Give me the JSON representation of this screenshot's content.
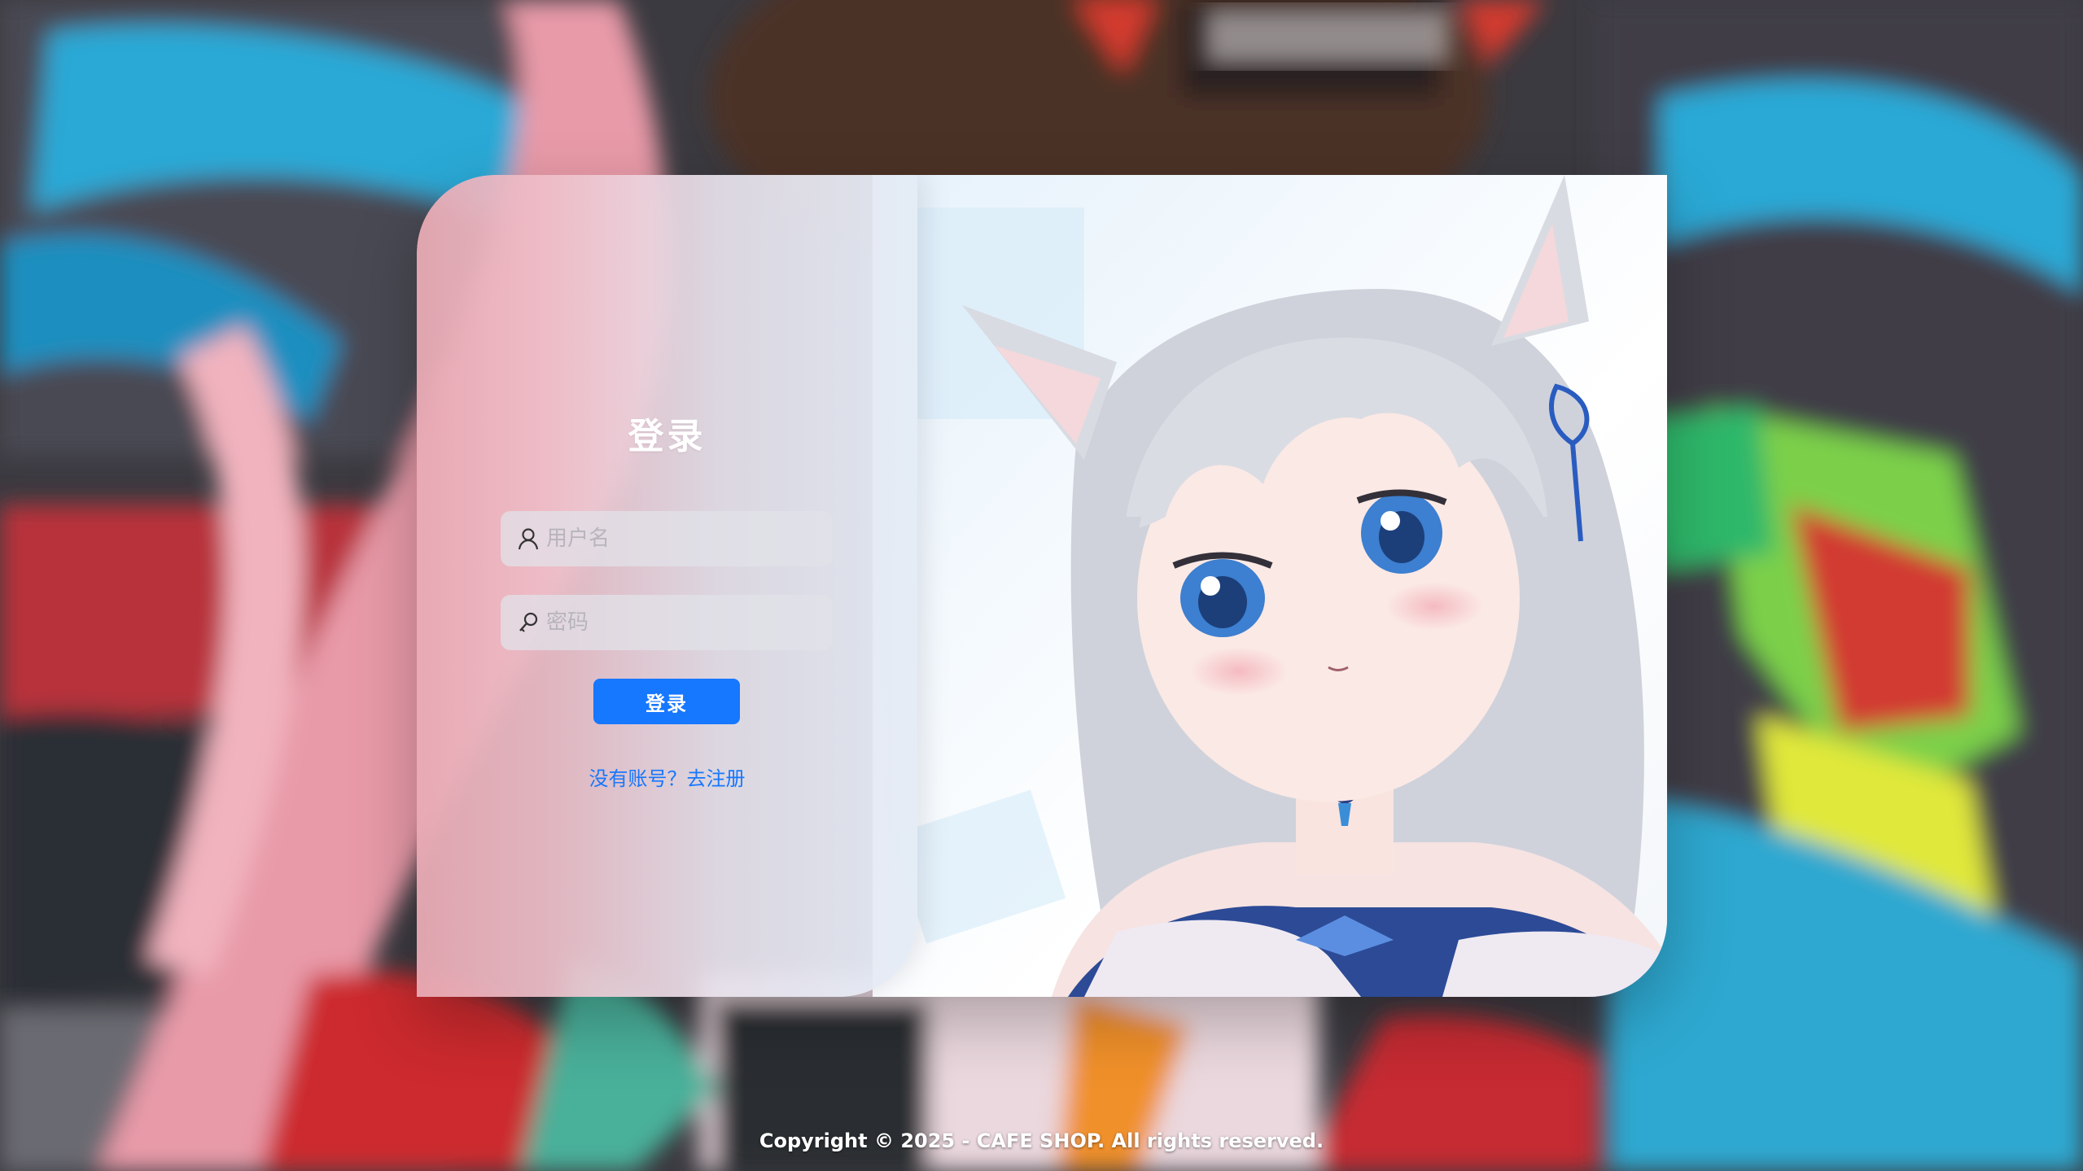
{
  "login": {
    "title": "登录",
    "username_placeholder": "用户名",
    "password_placeholder": "密码",
    "submit_label": "登录",
    "register_prompt": "没有账号？去注册"
  },
  "footer": {
    "copyright": "Copyright © 2025 - CAFE SHOP. All rights reserved."
  },
  "icons": {
    "username": "user-icon",
    "password": "key-icon"
  },
  "colors": {
    "primary": "#1677ff",
    "title": "#ffffff"
  }
}
